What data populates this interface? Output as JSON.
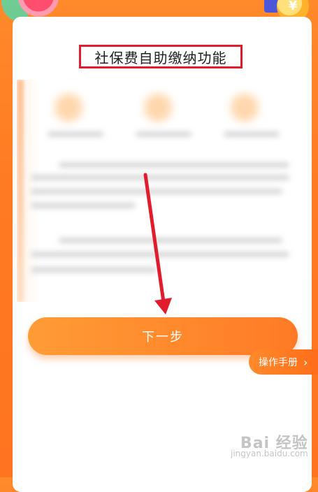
{
  "page": {
    "title": "社保费自助缴纳功能",
    "next_button_label": "下一步",
    "manual_button_label": "操作手册",
    "manual_chevron": "›",
    "coin_symbol": "¥"
  },
  "watermark": {
    "brand": "Bai 经验",
    "url": "jingyan.baidu.com"
  },
  "colors": {
    "accent": "#ff7a22",
    "highlight_box": "#e21b2d"
  },
  "icons": {
    "arrow": "arrow-down-icon",
    "chevron": "chevron-right-icon"
  }
}
